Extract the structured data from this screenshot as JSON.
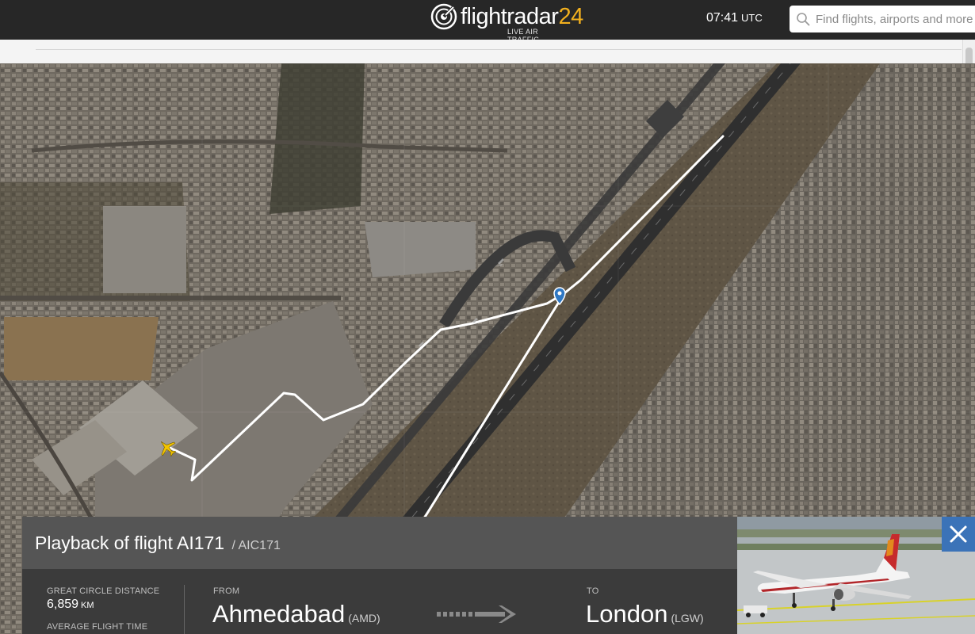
{
  "header": {
    "logo_text": "flightradar",
    "logo_num": "24",
    "logo_tagline": "LIVE AIR TRAFFIC",
    "clock_time": "07:41",
    "clock_zone": "UTC",
    "search_placeholder": "Find flights, airports and more"
  },
  "map": {
    "track_color": "#ffffff",
    "aircraft_color": "#f2c400",
    "marker_color": "#2f78c4"
  },
  "playback": {
    "title": "Playback of flight AI171",
    "callsign": "/ AIC171",
    "great_circle_label": "GREAT CIRCLE DISTANCE",
    "great_circle_value": "6,859",
    "great_circle_unit": "KM",
    "avg_flight_time_label": "AVERAGE FLIGHT TIME",
    "from_label": "FROM",
    "from_city": "Ahmedabad",
    "from_code": "(AMD)",
    "to_label": "TO",
    "to_city": "London",
    "to_code": "(LGW)"
  },
  "icons": {
    "logo": "flightradar-logo-icon",
    "search": "search-icon",
    "close": "close-icon",
    "arrow": "route-arrow-icon",
    "aircraft": "aircraft-icon",
    "marker": "location-pin-icon"
  }
}
